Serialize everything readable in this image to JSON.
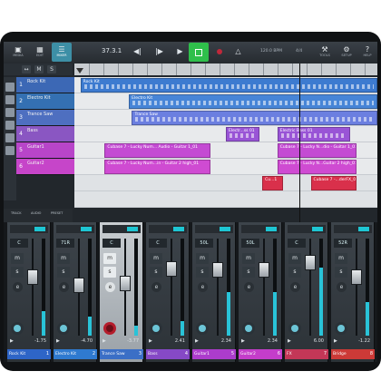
{
  "toolbar": {
    "media": {
      "icon": "media-icon",
      "label": "MEDIA"
    },
    "edit": {
      "icon": "edit-icon",
      "label": "EDIT"
    },
    "mixer": {
      "icon": "mixer-icon",
      "label": "MIXER"
    },
    "position": "37.3.1",
    "tempo": "120.0 BPM",
    "signature": "4/4",
    "tools": {
      "icon": "tools-icon",
      "label": "TOOLS"
    },
    "setup": {
      "icon": "gear-icon",
      "label": "SETUP"
    },
    "help": {
      "icon": "help-icon",
      "label": "HELP"
    },
    "accent": "#3d8fa6"
  },
  "arrange": {
    "tools": [
      "↔",
      "M",
      "S"
    ],
    "bottom": [
      "TRACK",
      "AUDIO",
      "PRESET"
    ],
    "tracks": [
      {
        "num": "1",
        "name": "Rock Kit",
        "color": "#3c68b5"
      },
      {
        "num": "2",
        "name": "Electro Kit",
        "color": "#3470b2"
      },
      {
        "num": "3",
        "name": "Trance Saw",
        "color": "#4e6fc0"
      },
      {
        "num": "4",
        "name": "Bass",
        "color": "#8a56c2"
      },
      {
        "num": "5",
        "name": "Guitar1",
        "color": "#b845c9"
      },
      {
        "num": "6",
        "name": "Guitar2",
        "color": "#c645c9"
      }
    ],
    "clips": [
      {
        "lane": 0,
        "start": 0.02,
        "end": 1.0,
        "name": "Rock Kit",
        "color": "#3d7bd0"
      },
      {
        "lane": 1,
        "start": 0.18,
        "end": 1.0,
        "name": "Electro Kit",
        "color": "#4785d7"
      },
      {
        "lane": 2,
        "start": 0.19,
        "end": 1.0,
        "name": "Trance Saw",
        "color": "#6b7fe0"
      },
      {
        "lane": 3,
        "start": 0.5,
        "end": 0.61,
        "name": "Electr...ss 01",
        "color": "#9954d6"
      },
      {
        "lane": 3,
        "start": 0.67,
        "end": 0.91,
        "name": "Electric Bass 01",
        "color": "#9954d6"
      },
      {
        "lane": 4,
        "start": 0.1,
        "end": 0.45,
        "name": "Cubase 7 - Lucky Num... Audio - Guitar 1_01",
        "color": "#c44bd3"
      },
      {
        "lane": 4,
        "start": 0.67,
        "end": 0.93,
        "name": "Cubase 7 - Lucky N...dio - Guitar 1_01",
        "color": "#c44bd3"
      },
      {
        "lane": 5,
        "start": 0.1,
        "end": 0.45,
        "name": "Cubase 7 - Lucky Num...in - Guitar 2 high_01",
        "color": "#cf4bd2"
      },
      {
        "lane": 5,
        "start": 0.67,
        "end": 0.93,
        "name": "Cubase 7 - Lucky N...Guitar 2 high_01",
        "color": "#cf4bd2"
      },
      {
        "lane": 6,
        "start": 0.62,
        "end": 0.69,
        "name": "Cu...1",
        "color": "#d9304b"
      },
      {
        "lane": 6,
        "start": 0.78,
        "end": 0.93,
        "name": "Cubase 7 -...derFX_01",
        "color": "#d9304b"
      }
    ]
  },
  "mixer": {
    "strips": [
      {
        "pan": "C",
        "name": "Rock Kit",
        "num": "1",
        "vol": "-1.75",
        "color": "#2e65c7",
        "fader": 0.62,
        "level": 0.25,
        "selected": false
      },
      {
        "pan": "71R",
        "name": "Electro Kit",
        "num": "2",
        "vol": "-4.70",
        "color": "#2f7ad0",
        "fader": 0.52,
        "level": 0.2,
        "selected": false
      },
      {
        "pan": "C",
        "name": "Trance Saw",
        "num": "3",
        "vol": "-3.77",
        "color": "#3b6fc6",
        "fader": 0.55,
        "level": 0.1,
        "selected": true
      },
      {
        "pan": "C",
        "name": "Bass",
        "num": "4",
        "vol": "2.41",
        "color": "#8649c6",
        "fader": 0.72,
        "level": 0.15,
        "selected": false
      },
      {
        "pan": "50L",
        "name": "Guitar1",
        "num": "5",
        "vol": "2.34",
        "color": "#ac3ccc",
        "fader": 0.71,
        "level": 0.45,
        "selected": false
      },
      {
        "pan": "50L",
        "name": "Guitar2",
        "num": "6",
        "vol": "2.34",
        "color": "#c43dca",
        "fader": 0.71,
        "level": 0.45,
        "selected": false
      },
      {
        "pan": "C",
        "name": "FX",
        "num": "7",
        "vol": "6.00",
        "color": "#c33757",
        "fader": 0.8,
        "level": 0.7,
        "selected": false
      },
      {
        "pan": "52R",
        "name": "Bridge",
        "num": "8",
        "vol": "-1.22",
        "color": "#cc3a37",
        "fader": 0.62,
        "level": 0.35,
        "selected": false
      }
    ],
    "labels": {
      "mute": "m",
      "solo": "s",
      "edit": "e",
      "play": "▶"
    }
  }
}
